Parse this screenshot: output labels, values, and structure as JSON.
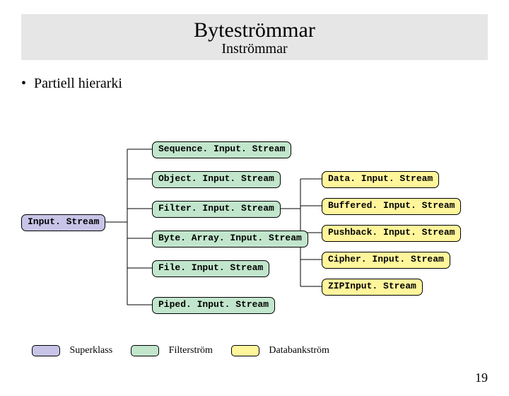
{
  "title": "Byteströmmar",
  "subtitle": "Inströmmar",
  "bullet": "Partiell hierarki",
  "nodes": {
    "root": "Input. Stream",
    "seq": "Sequence. Input. Stream",
    "obj": "Object. Input. Stream",
    "filter": "Filter. Input. Stream",
    "barr": "Byte. Array. Input. Stream",
    "file": "File. Input. Stream",
    "piped": "Piped. Input. Stream",
    "data": "Data. Input. Stream",
    "buf": "Buffered. Input. Stream",
    "push": "Pushback. Input. Stream",
    "cipher": "Cipher. Input. Stream",
    "zip": "ZIPInput. Stream"
  },
  "legend": {
    "super": "Superklass",
    "filter": "Filterström",
    "data": "Databankström"
  },
  "page_number": "19"
}
